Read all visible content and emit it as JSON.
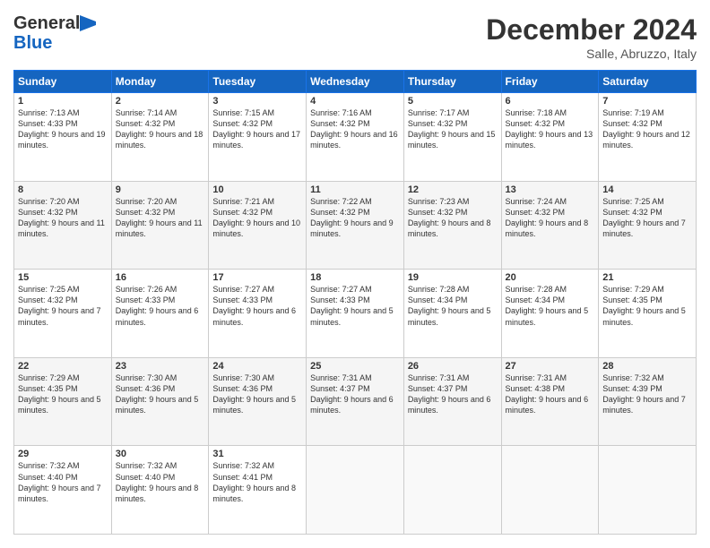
{
  "logo": {
    "line1": "General",
    "line2": "Blue"
  },
  "title": "December 2024",
  "location": "Salle, Abruzzo, Italy",
  "days_of_week": [
    "Sunday",
    "Monday",
    "Tuesday",
    "Wednesday",
    "Thursday",
    "Friday",
    "Saturday"
  ],
  "weeks": [
    [
      {
        "day": "1",
        "sunrise": "7:13 AM",
        "sunset": "4:33 PM",
        "daylight": "9 hours and 19 minutes."
      },
      {
        "day": "2",
        "sunrise": "7:14 AM",
        "sunset": "4:32 PM",
        "daylight": "9 hours and 18 minutes."
      },
      {
        "day": "3",
        "sunrise": "7:15 AM",
        "sunset": "4:32 PM",
        "daylight": "9 hours and 17 minutes."
      },
      {
        "day": "4",
        "sunrise": "7:16 AM",
        "sunset": "4:32 PM",
        "daylight": "9 hours and 16 minutes."
      },
      {
        "day": "5",
        "sunrise": "7:17 AM",
        "sunset": "4:32 PM",
        "daylight": "9 hours and 15 minutes."
      },
      {
        "day": "6",
        "sunrise": "7:18 AM",
        "sunset": "4:32 PM",
        "daylight": "9 hours and 13 minutes."
      },
      {
        "day": "7",
        "sunrise": "7:19 AM",
        "sunset": "4:32 PM",
        "daylight": "9 hours and 12 minutes."
      }
    ],
    [
      {
        "day": "8",
        "sunrise": "7:20 AM",
        "sunset": "4:32 PM",
        "daylight": "9 hours and 11 minutes."
      },
      {
        "day": "9",
        "sunrise": "7:20 AM",
        "sunset": "4:32 PM",
        "daylight": "9 hours and 11 minutes."
      },
      {
        "day": "10",
        "sunrise": "7:21 AM",
        "sunset": "4:32 PM",
        "daylight": "9 hours and 10 minutes."
      },
      {
        "day": "11",
        "sunrise": "7:22 AM",
        "sunset": "4:32 PM",
        "daylight": "9 hours and 9 minutes."
      },
      {
        "day": "12",
        "sunrise": "7:23 AM",
        "sunset": "4:32 PM",
        "daylight": "9 hours and 8 minutes."
      },
      {
        "day": "13",
        "sunrise": "7:24 AM",
        "sunset": "4:32 PM",
        "daylight": "9 hours and 8 minutes."
      },
      {
        "day": "14",
        "sunrise": "7:25 AM",
        "sunset": "4:32 PM",
        "daylight": "9 hours and 7 minutes."
      }
    ],
    [
      {
        "day": "15",
        "sunrise": "7:25 AM",
        "sunset": "4:32 PM",
        "daylight": "9 hours and 7 minutes."
      },
      {
        "day": "16",
        "sunrise": "7:26 AM",
        "sunset": "4:33 PM",
        "daylight": "9 hours and 6 minutes."
      },
      {
        "day": "17",
        "sunrise": "7:27 AM",
        "sunset": "4:33 PM",
        "daylight": "9 hours and 6 minutes."
      },
      {
        "day": "18",
        "sunrise": "7:27 AM",
        "sunset": "4:33 PM",
        "daylight": "9 hours and 5 minutes."
      },
      {
        "day": "19",
        "sunrise": "7:28 AM",
        "sunset": "4:34 PM",
        "daylight": "9 hours and 5 minutes."
      },
      {
        "day": "20",
        "sunrise": "7:28 AM",
        "sunset": "4:34 PM",
        "daylight": "9 hours and 5 minutes."
      },
      {
        "day": "21",
        "sunrise": "7:29 AM",
        "sunset": "4:35 PM",
        "daylight": "9 hours and 5 minutes."
      }
    ],
    [
      {
        "day": "22",
        "sunrise": "7:29 AM",
        "sunset": "4:35 PM",
        "daylight": "9 hours and 5 minutes."
      },
      {
        "day": "23",
        "sunrise": "7:30 AM",
        "sunset": "4:36 PM",
        "daylight": "9 hours and 5 minutes."
      },
      {
        "day": "24",
        "sunrise": "7:30 AM",
        "sunset": "4:36 PM",
        "daylight": "9 hours and 5 minutes."
      },
      {
        "day": "25",
        "sunrise": "7:31 AM",
        "sunset": "4:37 PM",
        "daylight": "9 hours and 6 minutes."
      },
      {
        "day": "26",
        "sunrise": "7:31 AM",
        "sunset": "4:37 PM",
        "daylight": "9 hours and 6 minutes."
      },
      {
        "day": "27",
        "sunrise": "7:31 AM",
        "sunset": "4:38 PM",
        "daylight": "9 hours and 6 minutes."
      },
      {
        "day": "28",
        "sunrise": "7:32 AM",
        "sunset": "4:39 PM",
        "daylight": "9 hours and 7 minutes."
      }
    ],
    [
      {
        "day": "29",
        "sunrise": "7:32 AM",
        "sunset": "4:40 PM",
        "daylight": "9 hours and 7 minutes."
      },
      {
        "day": "30",
        "sunrise": "7:32 AM",
        "sunset": "4:40 PM",
        "daylight": "9 hours and 8 minutes."
      },
      {
        "day": "31",
        "sunrise": "7:32 AM",
        "sunset": "4:41 PM",
        "daylight": "9 hours and 8 minutes."
      },
      null,
      null,
      null,
      null
    ]
  ],
  "labels": {
    "sunrise": "Sunrise:",
    "sunset": "Sunset:",
    "daylight": "Daylight:"
  }
}
